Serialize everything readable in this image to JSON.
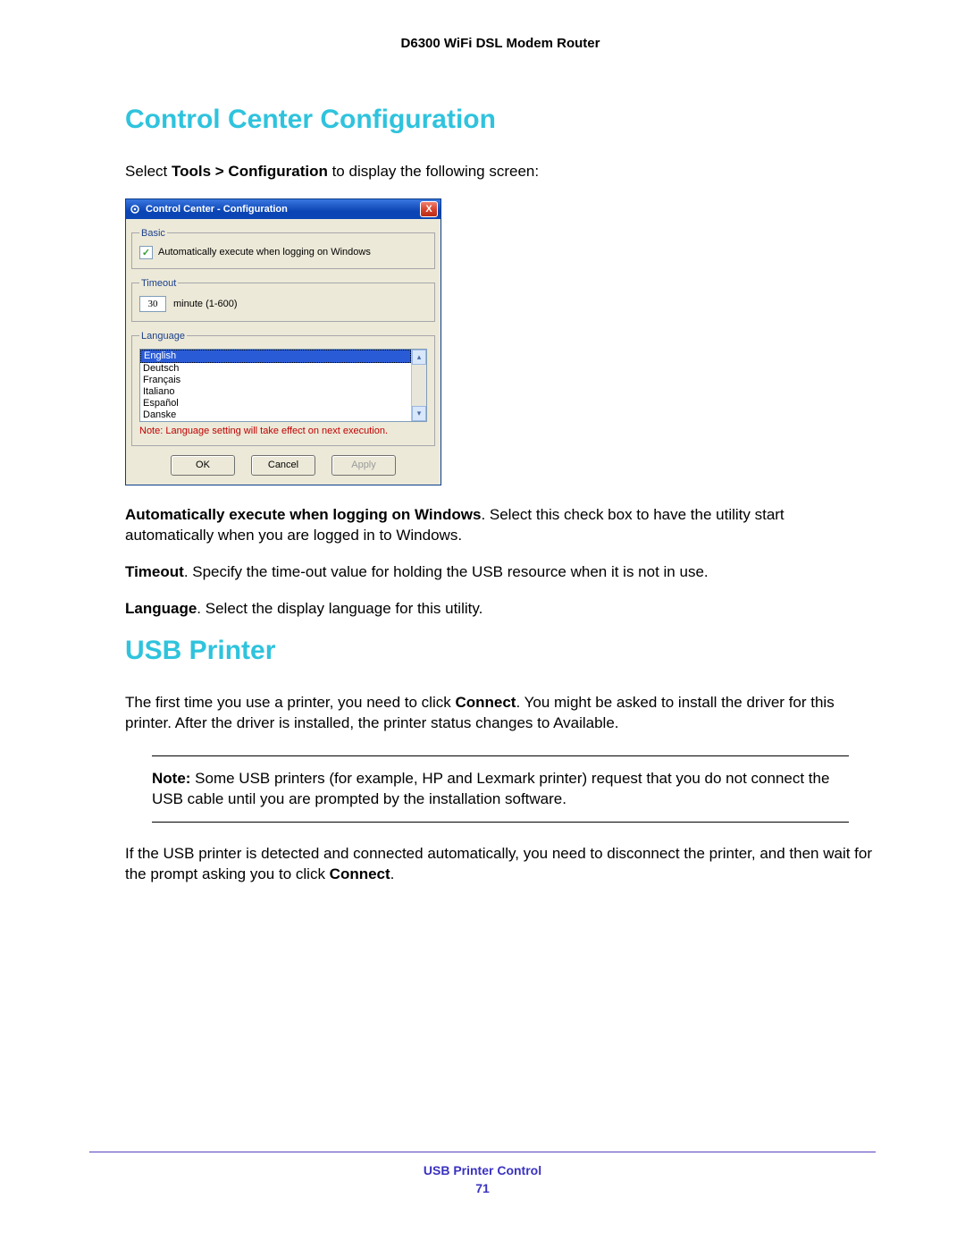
{
  "doc": {
    "header": "D6300 WiFi DSL Modem Router",
    "section1_title": "Control Center Configuration",
    "intro_prefix": "Select ",
    "intro_bold": "Tools > Configuration",
    "intro_suffix": " to display the following screen:"
  },
  "dialog": {
    "title": "Control Center - Configuration",
    "close_glyph": "X",
    "group_basic": "Basic",
    "chk_label": "Automatically execute when logging on Windows",
    "chk_mark": "✓",
    "group_timeout": "Timeout",
    "timeout_value": "30",
    "timeout_hint": "minute (1-600)",
    "group_language": "Language",
    "languages": {
      "l0": "English",
      "l1": "Deutsch",
      "l2": "Français",
      "l3": "Italiano",
      "l4": "Español",
      "l5": "Danske"
    },
    "lang_note": "Note: Language setting will take effect on next execution.",
    "btn_ok": "OK",
    "btn_cancel": "Cancel",
    "btn_apply": "Apply",
    "arrow_up": "▴",
    "arrow_down": "▾"
  },
  "descriptions": {
    "d1_bold": "Automatically execute when logging on Windows",
    "d1_rest": ". Select this check box to have the utility start automatically when you are logged in to Windows.",
    "d2_bold": "Timeout",
    "d2_rest": ". Specify the time-out value for holding the USB resource when it is not in use.",
    "d3_bold": "Language",
    "d3_rest": ". Select the display language for this utility."
  },
  "section2": {
    "title": "USB Printer",
    "p1_a": "The first time you use a printer, you need to click ",
    "p1_bold": "Connect",
    "p1_b": ". You might be asked to install the driver for this printer. After the driver is installed, the printer status changes to Available.",
    "note_label": "Note:  ",
    "note_text": "Some USB printers (for example, HP and Lexmark printer) request that you do not connect the USB cable until you are prompted by the installation software.",
    "p2_a": "If the USB printer is detected and connected automatically, you need to disconnect the printer, and then wait for the prompt asking you to click ",
    "p2_bold": "Connect",
    "p2_b": "."
  },
  "footer": {
    "chapter": "USB Printer Control",
    "page": "71"
  }
}
